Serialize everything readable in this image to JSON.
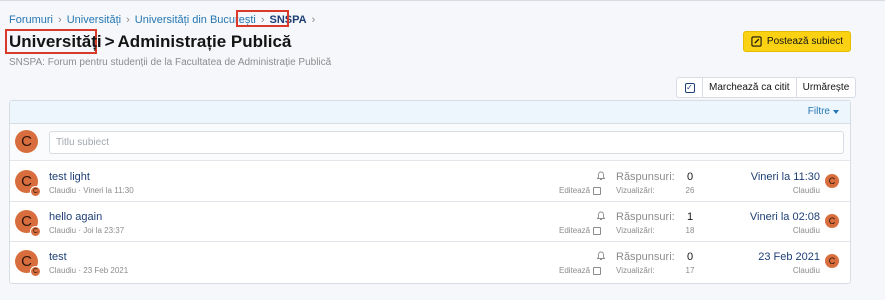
{
  "breadcrumb": {
    "items": [
      "Forumuri",
      "Universități",
      "Universități din București"
    ],
    "current": "SNSPA"
  },
  "page": {
    "title_parent": "Universități",
    "title_sep": ">",
    "title": "Administrație Publică",
    "description": "SNSPA: Forum pentru studenții de la Facultatea de Administrație Publică"
  },
  "actions": {
    "post_thread": "Postează subiect",
    "mark_read": "Marchează ca citit",
    "watch": "Urmărește"
  },
  "filters": {
    "label": "Filtre"
  },
  "new_thread": {
    "avatar_letter": "C",
    "placeholder": "Titlu subiect"
  },
  "threads": [
    {
      "title": "test light",
      "author": "Claudiu",
      "date": "Vineri la 11:30",
      "replies_label": "Răspunsuri:",
      "replies": "0",
      "views_label": "Vizualizări:",
      "views": "26",
      "edit_label": "Editează",
      "last_date": "Vineri la 11:30",
      "last_user": "Claudiu",
      "avatar_letter": "C"
    },
    {
      "title": "hello again",
      "author": "Claudiu",
      "date": "Joi la 23:37",
      "replies_label": "Răspunsuri:",
      "replies": "1",
      "views_label": "Vizualizări:",
      "views": "18",
      "edit_label": "Editează",
      "last_date": "Vineri la 02:08",
      "last_user": "Claudiu",
      "avatar_letter": "C"
    },
    {
      "title": "test",
      "author": "Claudiu",
      "date": "23 Feb 2021",
      "replies_label": "Răspunsuri:",
      "replies": "0",
      "views_label": "Vizualizări:",
      "views": "17",
      "edit_label": "Editează",
      "last_date": "23 Feb 2021",
      "last_user": "Claudiu",
      "avatar_letter": "C"
    }
  ],
  "meta_sep": " · ",
  "colors": {
    "accent": "#fad113",
    "link": "#2577b1",
    "title": "#1d3f75",
    "avatar": "#d86e3e",
    "highlight": "#d93a2a"
  }
}
